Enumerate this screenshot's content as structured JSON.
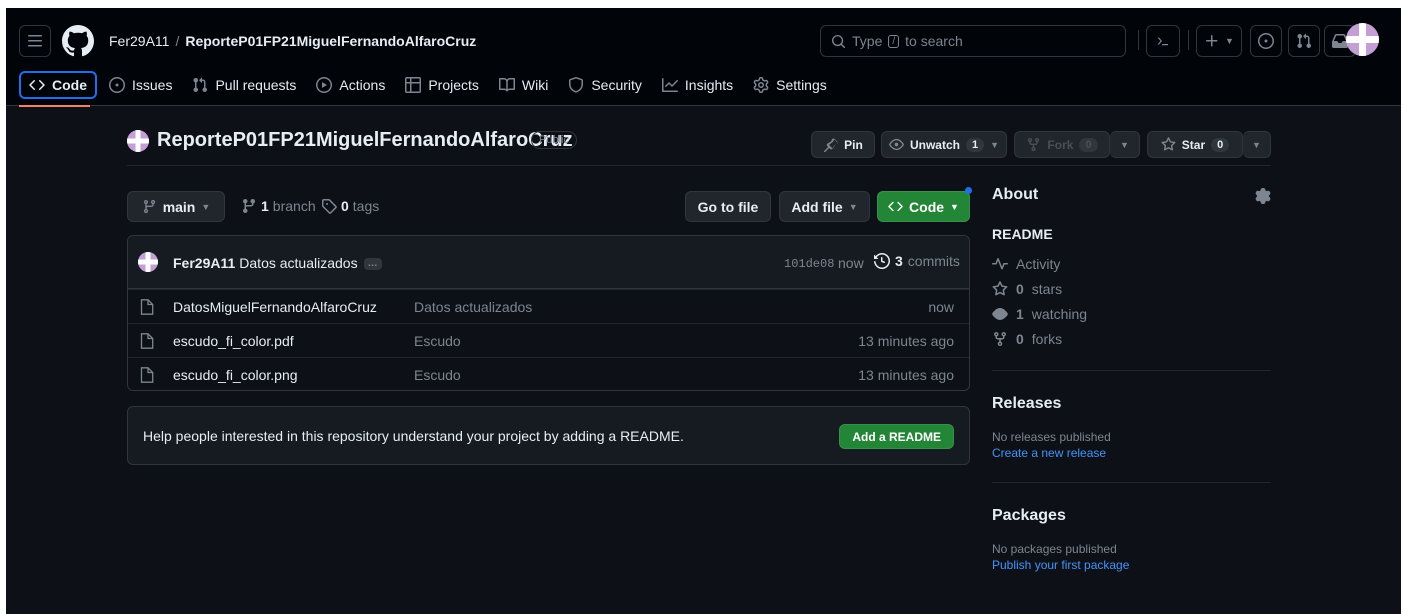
{
  "header": {
    "owner": "Fer29A11",
    "separator": "/",
    "repo": "ReporteP01FP21MiguelFernandoAlfaroCruz",
    "search_prefix": "Type",
    "search_key": "/",
    "search_suffix": "to search"
  },
  "tabs": [
    {
      "label": "Code",
      "icon": "code-icon",
      "active": true
    },
    {
      "label": "Issues",
      "icon": "issue-icon"
    },
    {
      "label": "Pull requests",
      "icon": "pull-request-icon"
    },
    {
      "label": "Actions",
      "icon": "play-icon"
    },
    {
      "label": "Projects",
      "icon": "table-icon"
    },
    {
      "label": "Wiki",
      "icon": "book-icon"
    },
    {
      "label": "Security",
      "icon": "shield-icon"
    },
    {
      "label": "Insights",
      "icon": "graph-icon"
    },
    {
      "label": "Settings",
      "icon": "gear-icon"
    }
  ],
  "repo_header": {
    "name": "ReporteP01FP21MiguelFernandoAlfaroCruz",
    "visibility": "Public",
    "pin_label": "Pin",
    "unwatch_label": "Unwatch",
    "unwatch_count": "1",
    "fork_label": "Fork",
    "fork_count": "0",
    "star_label": "Star",
    "star_count": "0"
  },
  "toolbar": {
    "branch": "main",
    "branch_count": "1",
    "branch_word": "branch",
    "tag_count": "0",
    "tag_word": "tags",
    "goto_file": "Go to file",
    "add_file": "Add file",
    "code": "Code"
  },
  "commit": {
    "author": "Fer29A11",
    "message": "Datos actualizados",
    "ellipsis": "…",
    "hash": "101de08",
    "time": "now",
    "count": "3",
    "count_word": "commits"
  },
  "files": [
    {
      "name": "DatosMiguelFernandoAlfaroCruz",
      "message": "Datos actualizados",
      "age": "now"
    },
    {
      "name": "escudo_fi_color.pdf",
      "message": "Escudo",
      "age": "13 minutes ago"
    },
    {
      "name": "escudo_fi_color.png",
      "message": "Escudo",
      "age": "13 minutes ago"
    }
  ],
  "readme_banner": {
    "text": "Help people interested in this repository understand your project by adding a README.",
    "button": "Add a README"
  },
  "about": {
    "title": "About",
    "readme": "README",
    "activity": "Activity",
    "stars_count": "0",
    "stars_word": "stars",
    "watching_count": "1",
    "watching_word": "watching",
    "forks_count": "0",
    "forks_word": "forks"
  },
  "releases": {
    "title": "Releases",
    "empty": "No releases published",
    "link": "Create a new release"
  },
  "packages": {
    "title": "Packages",
    "empty": "No packages published",
    "link": "Publish your first package"
  },
  "colors": {
    "background": "#0d1117",
    "header": "#010409",
    "accent_green": "#238636",
    "link_blue": "#4493f8",
    "tab_underline": "#f78166"
  }
}
